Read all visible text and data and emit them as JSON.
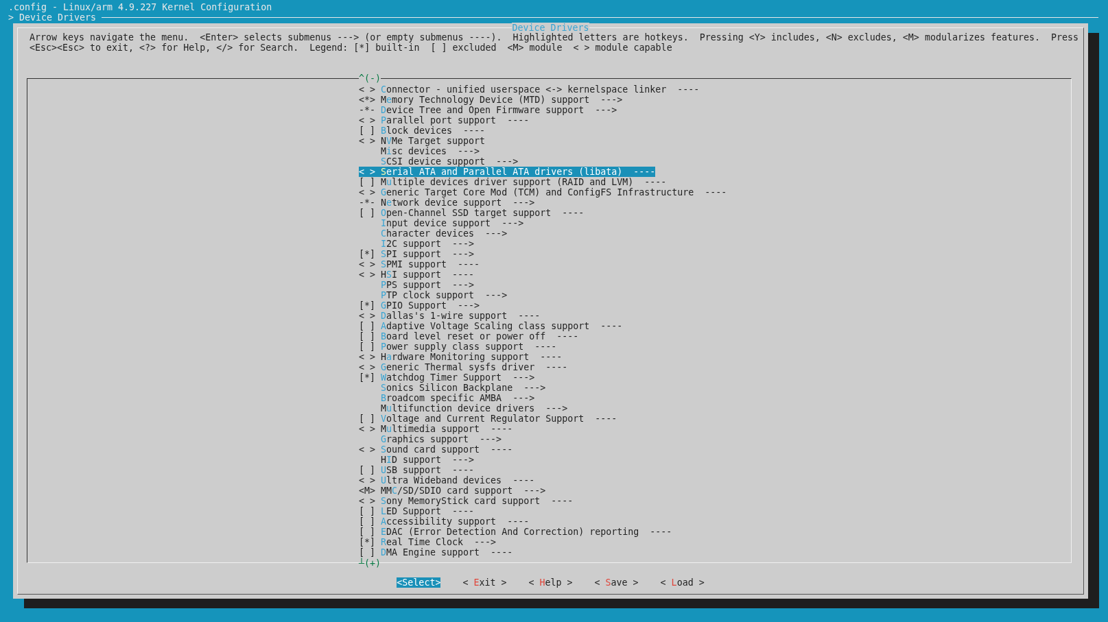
{
  "window": {
    "title": ".config - Linux/arm 4.9.227 Kernel Configuration"
  },
  "breadcrumb": "> Device Drivers",
  "dialog": {
    "title": "Device Drivers",
    "help_lines": [
      "Arrow keys navigate the menu.  <Enter> selects submenus ---> (or empty submenus ----).  Highlighted letters are hotkeys.  Pressing <Y> includes, <N> excludes, <M> modularizes features.  Press",
      "<Esc><Esc> to exit, <?> for Help, </> for Search.  Legend: [*] built-in  [ ] excluded  <M> module  < > module capable"
    ],
    "scroll_up": "^(-)",
    "scroll_down": "┴(+)",
    "items": [
      {
        "state": "< >",
        "key": "C",
        "rest": "onnector - unified userspace <-> kernelspace linker  ----",
        "selected": false
      },
      {
        "state": "<*>",
        "lead": "M",
        "key": "e",
        "rest": "mory Technology Device (MTD) support  --->",
        "selected": false
      },
      {
        "state": "-*-",
        "key": "D",
        "rest": "evice Tree and Open Firmware support  --->",
        "selected": false
      },
      {
        "state": "< >",
        "key": "P",
        "rest": "arallel port support  ----",
        "selected": false
      },
      {
        "state": "[ ]",
        "key": "B",
        "rest": "lock devices  ----",
        "selected": false
      },
      {
        "state": "< >",
        "lead": "N",
        "key": "V",
        "rest": "Me Target support",
        "selected": false
      },
      {
        "lead": "M",
        "key": "i",
        "rest": "sc devices  --->",
        "selected": false
      },
      {
        "key": "S",
        "rest": "CSI device support  --->",
        "selected": false
      },
      {
        "state": "< >",
        "key": "S",
        "rest": "erial ATA and Parallel ATA drivers (libata)  ----",
        "selected": true
      },
      {
        "state": "[ ]",
        "lead": "M",
        "key": "u",
        "rest": "ltiple devices driver support (RAID and LVM)  ----",
        "selected": false
      },
      {
        "state": "< >",
        "key": "G",
        "rest": "eneric Target Core Mod (TCM) and ConfigFS Infrastructure  ----",
        "selected": false
      },
      {
        "state": "-*-",
        "lead": "N",
        "key": "e",
        "rest": "twork device support  --->",
        "selected": false
      },
      {
        "state": "[ ]",
        "key": "O",
        "rest": "pen-Channel SSD target support  ----",
        "selected": false
      },
      {
        "key": "I",
        "rest": "nput device support  --->",
        "selected": false
      },
      {
        "key": "C",
        "rest": "haracter devices  --->",
        "selected": false
      },
      {
        "key": "I",
        "rest": "2C support  --->",
        "selected": false
      },
      {
        "state": "[*]",
        "key": "S",
        "rest": "PI support  --->",
        "selected": false
      },
      {
        "state": "< >",
        "key": "S",
        "rest": "PMI support  ----",
        "selected": false
      },
      {
        "state": "< >",
        "lead": "H",
        "key": "S",
        "rest": "I support  ----",
        "selected": false
      },
      {
        "key": "P",
        "rest": "PS support  --->",
        "selected": false
      },
      {
        "key": "P",
        "rest": "TP clock support  --->",
        "selected": false
      },
      {
        "state": "[*]",
        "key": "G",
        "rest": "PIO Support  --->",
        "selected": false
      },
      {
        "state": "< >",
        "key": "D",
        "rest": "allas's 1-wire support  ----",
        "selected": false
      },
      {
        "state": "[ ]",
        "key": "A",
        "rest": "daptive Voltage Scaling class support  ----",
        "selected": false
      },
      {
        "state": "[ ]",
        "key": "B",
        "rest": "oard level reset or power off  ----",
        "selected": false
      },
      {
        "state": "[ ]",
        "key": "P",
        "rest": "ower supply class support  ----",
        "selected": false
      },
      {
        "state": "< >",
        "lead": "H",
        "key": "a",
        "rest": "rdware Monitoring support  ----",
        "selected": false
      },
      {
        "state": "< >",
        "key": "G",
        "rest": "eneric Thermal sysfs driver  ----",
        "selected": false
      },
      {
        "state": "[*]",
        "key": "W",
        "rest": "atchdog Timer Support  --->",
        "selected": false
      },
      {
        "key": "S",
        "rest": "onics Silicon Backplane  --->",
        "selected": false
      },
      {
        "key": "B",
        "rest": "roadcom specific AMBA  --->",
        "selected": false
      },
      {
        "lead": "M",
        "key": "u",
        "rest": "ltifunction device drivers  --->",
        "selected": false
      },
      {
        "state": "[ ]",
        "key": "V",
        "rest": "oltage and Current Regulator Support  ----",
        "selected": false
      },
      {
        "state": "< >",
        "lead": "M",
        "key": "u",
        "rest": "ltimedia support  ----",
        "selected": false
      },
      {
        "key": "G",
        "rest": "raphics support  --->",
        "selected": false
      },
      {
        "state": "< >",
        "key": "S",
        "rest": "ound card support  ----",
        "selected": false
      },
      {
        "lead": "H",
        "key": "I",
        "rest": "D support  --->",
        "selected": false
      },
      {
        "state": "[ ]",
        "key": "U",
        "rest": "SB support  ----",
        "selected": false
      },
      {
        "state": "< >",
        "key": "U",
        "rest": "ltra Wideband devices  ----",
        "selected": false
      },
      {
        "state": "<M>",
        "lead": "MM",
        "key": "C",
        "rest": "/SD/SDIO card support  --->",
        "selected": false
      },
      {
        "state": "< >",
        "key": "S",
        "rest": "ony MemoryStick card support  ----",
        "selected": false
      },
      {
        "state": "[ ]",
        "key": "L",
        "rest": "ED Support  ----",
        "selected": false
      },
      {
        "state": "[ ]",
        "key": "A",
        "rest": "ccessibility support  ----",
        "selected": false
      },
      {
        "state": "[ ]",
        "key": "E",
        "rest": "DAC (Error Detection And Correction) reporting  ----",
        "selected": false
      },
      {
        "state": "[*]",
        "key": "R",
        "rest": "eal Time Clock  --->",
        "selected": false
      },
      {
        "state": "[ ]",
        "key": "D",
        "rest": "MA Engine support  ----",
        "selected": false
      }
    ],
    "buttons": [
      {
        "lead": "<",
        "key": "S",
        "rest": "elect>",
        "selected": true
      },
      {
        "lead": "< ",
        "key": "E",
        "rest": "xit >",
        "selected": false
      },
      {
        "lead": "< ",
        "key": "H",
        "rest": "elp >",
        "selected": false
      },
      {
        "lead": "< ",
        "key": "S",
        "rest": "ave >",
        "selected": false
      },
      {
        "lead": "< ",
        "key": "L",
        "rest": "oad >",
        "selected": false
      }
    ]
  }
}
